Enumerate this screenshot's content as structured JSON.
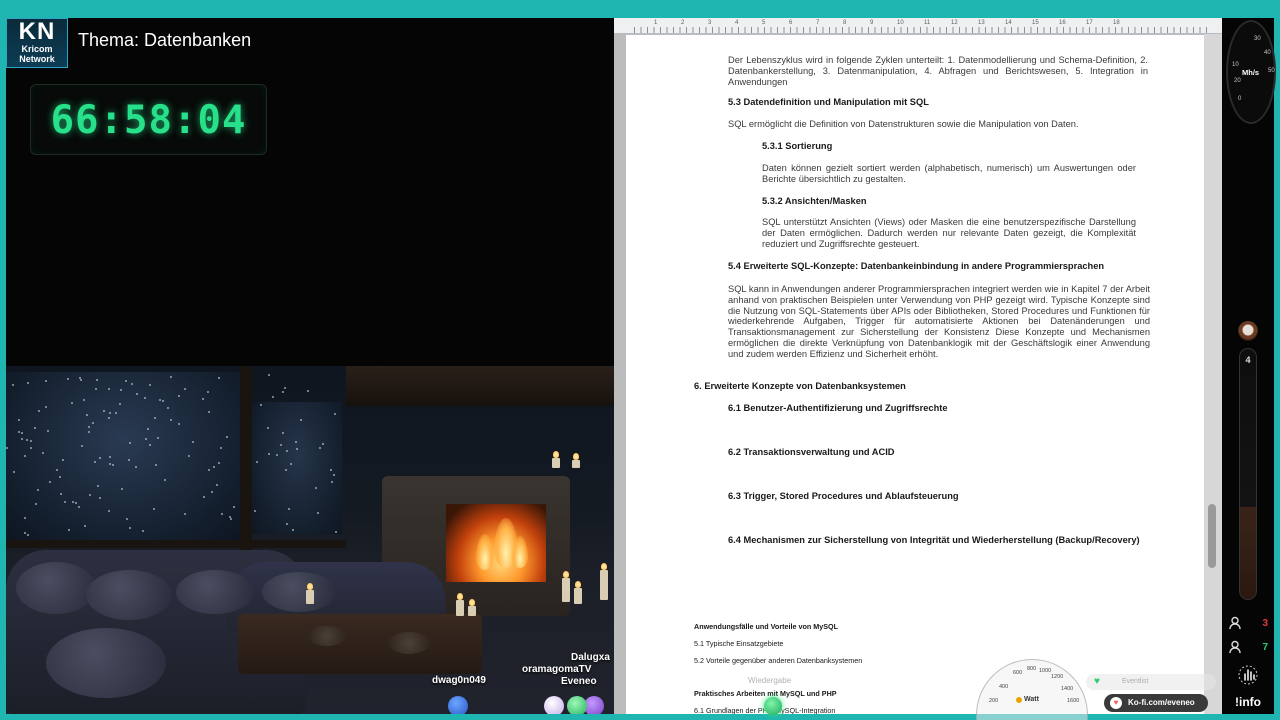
{
  "header": {
    "logo_big": "KN",
    "logo_line1": "Kricom",
    "logo_line2": "Network",
    "title": "Thema: Datenbanken"
  },
  "timer": {
    "value": "66:58:04",
    "color": "#27e08a"
  },
  "viewers": [
    "Dalugxa",
    "oramagomaTV",
    "Eveneo",
    "dwag0n049"
  ],
  "document": {
    "ruler_numbers": [
      "1",
      "2",
      "3",
      "4",
      "5",
      "6",
      "7",
      "8",
      "9",
      "10",
      "11",
      "12",
      "13",
      "14",
      "15",
      "16",
      "17",
      "18"
    ],
    "intro_text": "Der Lebenszyklus wird in folgende Zyklen unterteilt: 1. Datenmodellierung und Schema-Definition, 2. Datenbankerstellung, 3. Datenmanipulation, 4. Abfragen und Berichtswesen, 5. Integration in Anwendungen",
    "h_5_3": "5.3 Datendefinition und Manipulation mit SQL",
    "p_5_3": "SQL ermöglicht die Definition von Datenstrukturen sowie die Manipulation von Daten.",
    "h_5_3_1": "5.3.1 Sortierung",
    "p_5_3_1": "Daten können gezielt sortiert werden (alphabetisch, numerisch) um Auswertungen oder Berichte übersichtlich zu gestalten.",
    "h_5_3_2": "5.3.2 Ansichten/Masken",
    "p_5_3_2": "SQL unterstützt Ansichten (Views) oder Masken die eine benutzerspezifische Darstellung der Daten ermöglichen. Dadurch werden nur relevante Daten gezeigt, die Komplexität reduziert und Zugriffsrechte gesteuert.",
    "h_5_4": "5.4 Erweiterte SQL-Konzepte: Datenbankeinbindung in andere Programmiersprachen",
    "p_5_4": "SQL kann in Anwendungen anderer Programmiersprachen integriert werden wie in Kapitel 7 der Arbeit anhand von praktischen Beispielen unter Verwendung von PHP gezeigt wird. Typische Konzepte sind die Nutzung von SQL-Statements über APIs oder Bibliotheken, Stored Procedures und Funktionen für wiederkehrende Aufgaben, Trigger für automatisierte Aktionen bei Datenänderungen und Transaktionsmanagement zur Sicherstellung der Konsistenz Diese Konzepte und Mechanismen ermöglichen die direkte Verknüpfung von Datenbanklogik mit der Geschäftslogik einer Anwendung und zudem werden Effizienz und Sicherheit erhöht.",
    "h_6": "6. Erweiterte Konzepte von Datenbanksystemen",
    "h_6_1": "6.1 Benutzer-Authentifizierung und Zugriffsrechte",
    "h_6_2": "6.2 Transaktionsverwaltung und ACID",
    "h_6_3": "6.3 Trigger, Stored Procedures und Ablaufsteuerung",
    "h_6_4": "6.4 Mechanismen zur Sicherstellung von Integrität und Wiederherstellung (Backup/Recovery)",
    "small_h1": "Anwendungsfälle und Vorteile von MySQL",
    "small_1": "5.1 Typische Einsatzgebiete",
    "small_2": "5.2 Vorteile gegenüber anderen Datenbanksystemen",
    "small_h2": "Praktisches Arbeiten mit MySQL und PHP",
    "small_3": "6.1 Grundlagen der PHP-MySQL-Integration"
  },
  "sidebar": {
    "gauge_label": "Mh/s",
    "gauge_numbers": [
      "30",
      "40",
      "50",
      "10",
      "20",
      "0"
    ],
    "tube_label": "4",
    "tube_level": 0.37,
    "count_red": "3",
    "count_green": "7",
    "info_label": "!info"
  },
  "overlays": {
    "watt_label": "Watt",
    "watt_numbers": [
      "600",
      "800",
      "1000",
      "1200",
      "400",
      "1400",
      "200",
      "1600"
    ],
    "faded_label": "Wiedergabe",
    "heart_text": "Eventlist",
    "kofi_text": "Ko-fi.com/eveneo"
  },
  "colors": {
    "frame": "#1fb5b0",
    "timer": "#27e08a",
    "count_red": "#e23b3b",
    "count_green": "#2ecc71"
  }
}
